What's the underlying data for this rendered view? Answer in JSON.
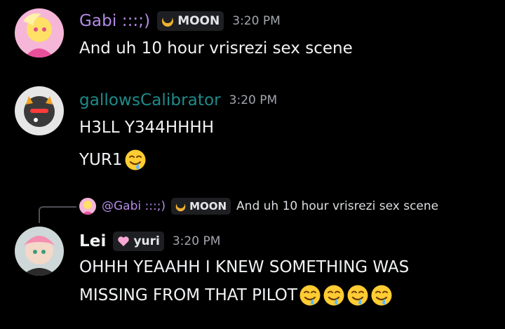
{
  "messages": [
    {
      "author": "Gabi :::;)",
      "author_color": "#b48be4",
      "tag": "MOON",
      "time": "3:20 PM",
      "lines": [
        "And uh 10 hour vrisrezi sex scene"
      ]
    },
    {
      "author": "gallowsCalibrator",
      "author_color": "#1f8b8b",
      "time": "3:20 PM",
      "lines": [
        "H3LL Y344HHHH",
        "YUR1"
      ]
    },
    {
      "reply_to": {
        "author": "@Gabi :::;)",
        "tag": "MOON",
        "text": "And uh 10 hour vrisrezi sex scene"
      },
      "author": "Lei",
      "author_color": "#f2f3f5",
      "tag": "yuri",
      "time": "3:20 PM",
      "lines": [
        "OHHH YEAAHH I KNEW SOMETHING WAS",
        "MISSING FROM THAT PILOT"
      ]
    }
  ],
  "icons": {
    "moon_tag": "crescent-moon-icon",
    "yuri_tag": "pink-heart-icon",
    "emoji": "drooling-face-emoji"
  }
}
